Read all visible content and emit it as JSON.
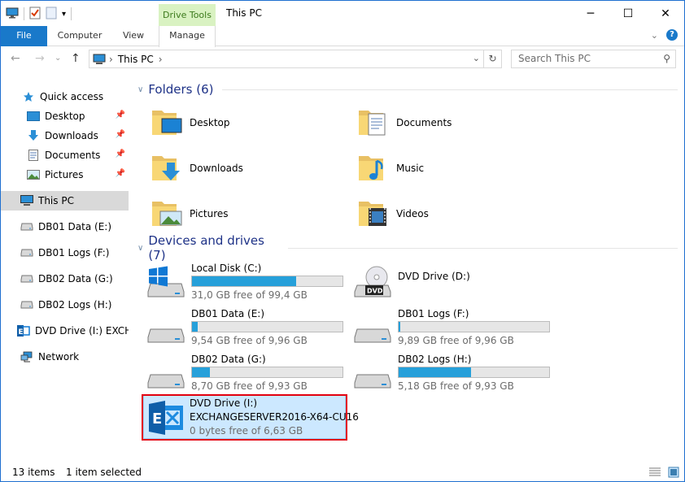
{
  "window": {
    "title": "This PC",
    "context_tab": "Drive Tools",
    "minimize": "─",
    "maximize": "☐",
    "close": "✕"
  },
  "ribbon": {
    "tabs": [
      "File",
      "Computer",
      "View",
      "Manage"
    ],
    "collapse": "⌄",
    "help": "?"
  },
  "address": {
    "back": "←",
    "forward": "→",
    "recent": "⌄",
    "up": "↑",
    "path": "This PC",
    "path_chevron": "›",
    "refresh": "↻",
    "dropdown": "⌄",
    "search_placeholder": "Search This PC",
    "search_icon": "⚲"
  },
  "sidebar": {
    "items": [
      {
        "label": "Quick access",
        "icon": "star-icon"
      },
      {
        "label": "Desktop",
        "icon": "desktop-icon"
      },
      {
        "label": "Downloads",
        "icon": "download-icon"
      },
      {
        "label": "Documents",
        "icon": "document-icon"
      },
      {
        "label": "Pictures",
        "icon": "pictures-icon"
      },
      {
        "label": "This PC",
        "icon": "computer-icon"
      },
      {
        "label": "DB01 Data (E:)",
        "icon": "drive-icon"
      },
      {
        "label": "DB01 Logs (F:)",
        "icon": "drive-icon"
      },
      {
        "label": "DB02 Data (G:)",
        "icon": "drive-icon"
      },
      {
        "label": "DB02 Logs (H:)",
        "icon": "drive-icon"
      },
      {
        "label": "DVD Drive (I:) EXCHA",
        "icon": "exchange-icon"
      },
      {
        "label": "Network",
        "icon": "network-icon"
      }
    ],
    "pin": "📌"
  },
  "folders_group": {
    "title": "Folders (6)",
    "items": [
      {
        "label": "Desktop",
        "icon": "desktop-folder-icon"
      },
      {
        "label": "Documents",
        "icon": "documents-folder-icon"
      },
      {
        "label": "Downloads",
        "icon": "downloads-folder-icon"
      },
      {
        "label": "Music",
        "icon": "music-folder-icon"
      },
      {
        "label": "Pictures",
        "icon": "pictures-folder-icon"
      },
      {
        "label": "Videos",
        "icon": "videos-folder-icon"
      }
    ]
  },
  "drives_group": {
    "title": "Devices and drives (7)",
    "items": [
      {
        "name": "Local Disk (C:)",
        "free": "31,0 GB free of 99,4 GB",
        "used_fraction": 0.69,
        "icon": "windows-drive-icon"
      },
      {
        "name": "DVD Drive (D:)",
        "icon": "dvd-drive-icon"
      },
      {
        "name": "DB01 Data (E:)",
        "free": "9,54 GB free of 9,96 GB",
        "used_fraction": 0.04,
        "icon": "hard-drive-icon"
      },
      {
        "name": "DB01 Logs (F:)",
        "free": "9,89 GB free of 9,96 GB",
        "used_fraction": 0.01,
        "icon": "hard-drive-icon"
      },
      {
        "name": "DB02 Data (G:)",
        "free": "8,70 GB free of 9,93 GB",
        "used_fraction": 0.12,
        "icon": "hard-drive-icon"
      },
      {
        "name": "DB02 Logs (H:)",
        "free": "5,18 GB free of 9,93 GB",
        "used_fraction": 0.48,
        "icon": "hard-drive-icon"
      },
      {
        "name": "DVD Drive (I:)",
        "name2": "EXCHANGESERVER2016-X64-CU16",
        "free": "0 bytes free of 6,63 GB",
        "icon": "exchange-icon",
        "selected": true
      }
    ]
  },
  "status": {
    "items": "13 items",
    "selected": "1 item selected"
  },
  "colors": {
    "accent": "#1979ca",
    "bar_fill": "#26a0da",
    "selection": "#cce8ff",
    "highlight_box": "#e3000f",
    "group_title": "#1e3287"
  }
}
